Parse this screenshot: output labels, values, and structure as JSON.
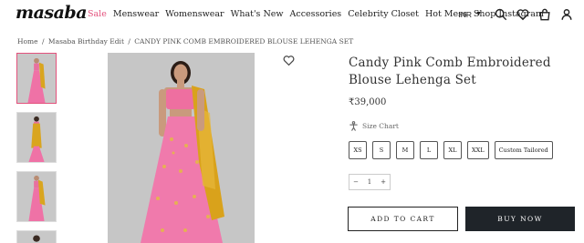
{
  "header": {
    "logo": "masaba",
    "nav": [
      {
        "label": "Sale",
        "active": true
      },
      {
        "label": "Menswear",
        "active": false
      },
      {
        "label": "Womenswear",
        "active": false
      },
      {
        "label": "What's New",
        "active": false
      },
      {
        "label": "Accessories",
        "active": false
      },
      {
        "label": "Celebrity Closet",
        "active": false
      },
      {
        "label": "Hot Mess",
        "active": false
      },
      {
        "label": "Shop Instagram",
        "active": false
      }
    ],
    "currency": "INR",
    "icons": [
      "search-icon",
      "heart-icon",
      "bag-icon",
      "user-icon"
    ],
    "accent_color": "#e3517c"
  },
  "breadcrumb": {
    "items": [
      "Home",
      "Masaba Birthday Edit",
      "CANDY PINK COMB EMBROIDERED BLOUSE LEHENGA SET"
    ],
    "separator": "/"
  },
  "product": {
    "title": "Candy Pink Comb Embroidered Blouse Lehenga Set",
    "price": "₹39,000",
    "size_chart_label": "Size Chart",
    "sizes": [
      "XS",
      "S",
      "M",
      "L",
      "XL",
      "XXL",
      "Custom Tailored"
    ],
    "quantity": "1",
    "qty_minus": "−",
    "qty_plus": "+",
    "add_to_cart": "ADD TO CART",
    "buy_now": "BUY NOW"
  }
}
